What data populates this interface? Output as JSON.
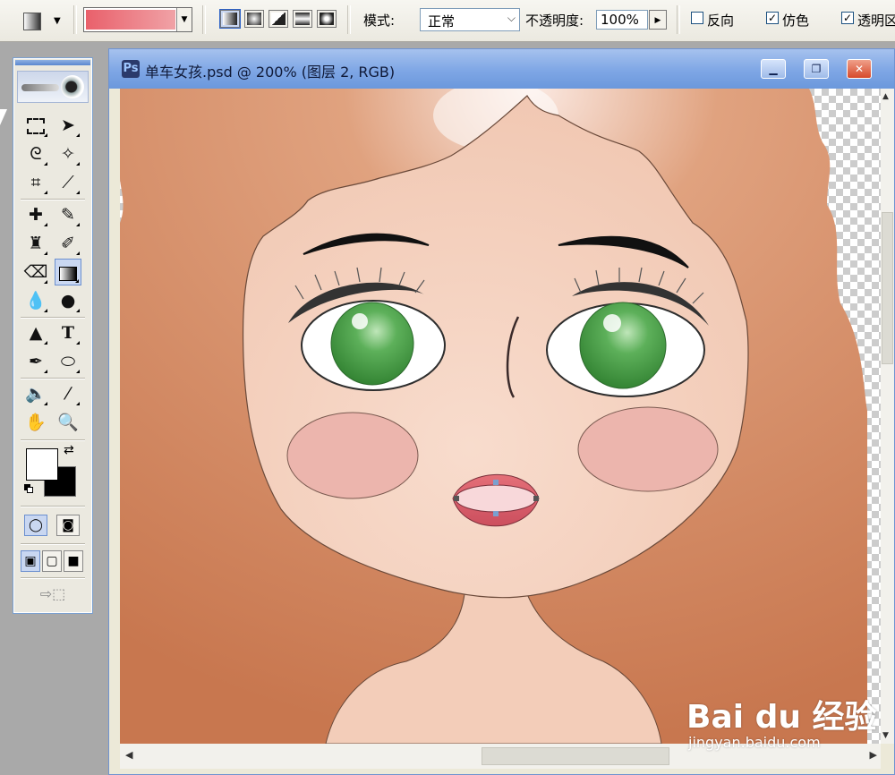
{
  "options_bar": {
    "mode_label": "模式:",
    "mode_value": "正常",
    "opacity_label": "不透明度:",
    "opacity_value": "100%",
    "reverse_label": "反向",
    "reverse_checked": false,
    "dither_label": "仿色",
    "dither_checked": true,
    "transparency_label": "透明区",
    "transparency_checked": true,
    "gradient_colors": [
      "#e9606b",
      "#f0a2a6"
    ]
  },
  "document": {
    "title": "单车女孩.psd @ 200% (图层 2, RGB)",
    "icon": "ps-doc-icon"
  },
  "toolbox": {
    "foreground_color": "#ffffff",
    "background_color": "#000000"
  },
  "watermark": {
    "brand": "Bai du 经验",
    "url": "jingyan.baidu.com"
  },
  "colors": {
    "hair": "#c8774f",
    "skin": "#f2cbb7",
    "cheek": "#ecb5ad",
    "eye_iris": "#3f9a3c",
    "lips": "#d75a66"
  }
}
